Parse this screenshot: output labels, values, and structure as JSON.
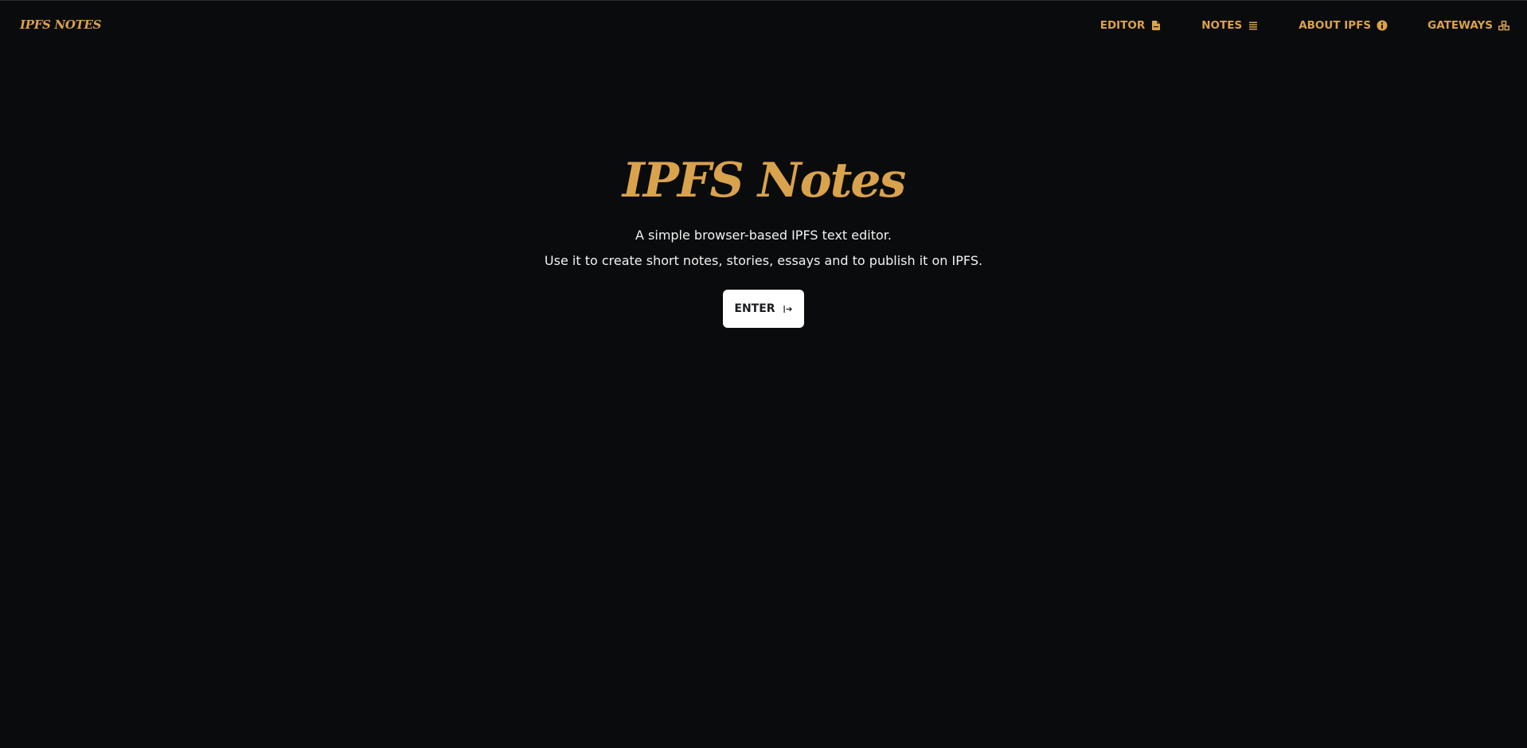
{
  "app": {
    "logo_text": "IPFS NOTES"
  },
  "nav": {
    "items": [
      {
        "label": "EDITOR",
        "icon": "file-icon"
      },
      {
        "label": "NOTES",
        "icon": "list-icon"
      },
      {
        "label": "ABOUT IPFS",
        "icon": "info-icon"
      },
      {
        "label": "GATEWAYS",
        "icon": "cubes-icon"
      }
    ]
  },
  "hero": {
    "title": "IPFS Notes",
    "line1": "A simple browser-based IPFS text editor.",
    "line2": "Use it to create short notes, stories, essays and to publish it on IPFS.",
    "enter_label": "ENTER",
    "enter_icon": "sign-in-icon"
  },
  "colors": {
    "background": "#0a0b0d",
    "accent": "#d9a24c",
    "text": "#f2f2f2",
    "button_bg": "#ffffff",
    "button_text": "#1a1b1e"
  }
}
